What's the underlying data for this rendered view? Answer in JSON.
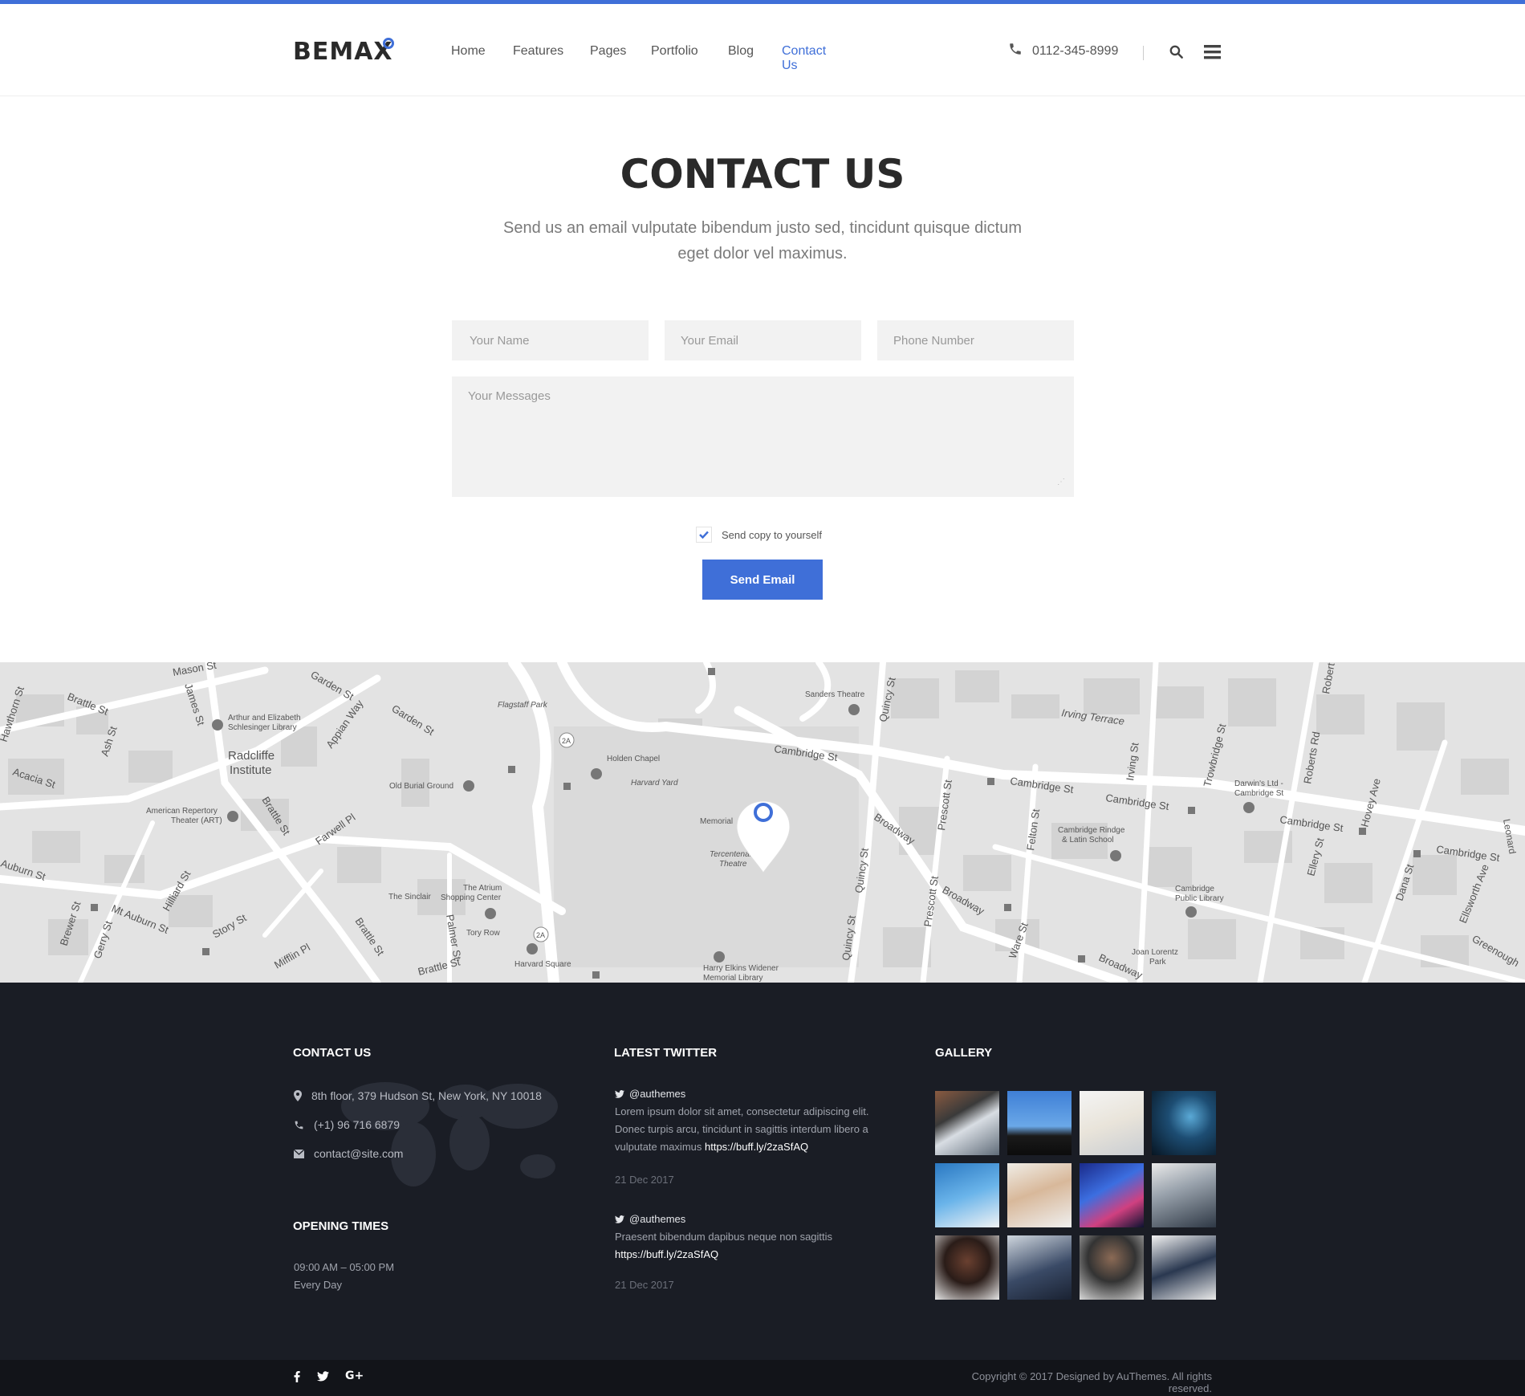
{
  "theme": {
    "accent": "#3f6fd8",
    "footer_bg": "#1a1d25",
    "bottom_bg": "#121419",
    "field_bg": "#f2f2f2"
  },
  "header": {
    "logo": "BEMAX",
    "nav": [
      {
        "label": "Home",
        "active": false
      },
      {
        "label": "Features",
        "active": false
      },
      {
        "label": "Pages",
        "active": false
      },
      {
        "label": "Portfolio",
        "active": false
      },
      {
        "label": "Blog",
        "active": false
      },
      {
        "label": "Contact Us",
        "active": true
      }
    ],
    "phone": "0112-345-8999",
    "icons": [
      "phone-icon",
      "search-icon",
      "menu-icon"
    ]
  },
  "contact": {
    "title": "CONTACT US",
    "subtitle": "Send us an email vulputate bibendum justo sed, tincidunt quisque dictum eget dolor vel maximus.",
    "form": {
      "name_placeholder": "Your Name",
      "email_placeholder": "Your Email",
      "phone_placeholder": "Phone Number",
      "message_placeholder": "Your Messages",
      "copy_label": "Send copy to yourself",
      "copy_checked": true,
      "submit_label": "Send Email"
    }
  },
  "map": {
    "labels": {
      "flagstaff": "Flagstaff Park",
      "sanders": "Sanders Theatre",
      "harvard_yard": "Harvard Yard",
      "holden": "Holden Chapel",
      "memorial": "Memorial",
      "tercentenary": "Tercentenary",
      "theatre": "Theatre",
      "radcliffe1": "Radcliffe",
      "radcliffe2": "Institute",
      "schlesinger1": "Arthur and Elizabeth",
      "schlesinger2": "Schlesinger Library",
      "burial": "Old Burial Ground",
      "art1": "American Repertory",
      "art2": "Theater (ART)",
      "sinclair": "The Sinclair",
      "atrium1": "The Atrium",
      "atrium2": "Shopping Center",
      "tory": "Tory Row",
      "harvard_sq": "Harvard Square",
      "widener1": "Harry Elkins Widener",
      "widener2": "Memorial Library",
      "crls1": "Cambridge Rindge",
      "crls2": "& Latin School",
      "cpl1": "Cambridge",
      "cpl2": "Public Library",
      "darwin1": "Darwin's Ltd -",
      "darwin2": "Cambridge St",
      "joan1": "Joan Lorentz",
      "joan2": "Park",
      "irving_terrace": "Irving Terrace",
      "cambridge_st": "Cambridge St",
      "broadway": "Broadway",
      "quincy": "Quincy St",
      "prescott": "Prescott St",
      "felton": "Felton St",
      "brattle": "Brattle St",
      "mason": "Mason St",
      "garden": "Garden St",
      "appian": "Appian Way",
      "farwell": "Farwell Pl",
      "mt_auburn": "Mt Auburn St",
      "story": "Story St",
      "hilliard": "Hilliard St",
      "mifflin": "Mifflin Pl",
      "palmer": "Palmer St",
      "acacia": "Acacia St",
      "auburn": "Auburn St",
      "hawthorn": "Hawthorn St",
      "ash": "Ash St",
      "james": "James St",
      "brewer": "Brewer St",
      "gerry": "Gerry St",
      "ellery": "Ellery St",
      "dana": "Dana St",
      "ellsworth": "Ellsworth Ave",
      "greenough": "Greenough",
      "irving": "Irving St",
      "trowbridge": "Trowbridge St",
      "roberts": "Roberts Rd",
      "hovey": "Hovey Ave",
      "robert": "Robert",
      "ware": "Ware St",
      "route_2a": "2A",
      "leonard": "Leonard"
    }
  },
  "footer": {
    "contact": {
      "heading": "CONTACT US",
      "address": "8th floor, 379 Hudson St, New York, NY 10018",
      "phone": "(+1) 96 716 6879",
      "email": "contact@site.com"
    },
    "opening": {
      "heading": "OPENING TIMES",
      "hours": "09:00 AM – 05:00 PM",
      "days": "Every Day"
    },
    "twitter": {
      "heading": "LATEST TWITTER",
      "tweets": [
        {
          "handle": "@authemes",
          "text": "Lorem ipsum dolor sit amet, consectetur adipiscing elit. Donec turpis arcu, tincidunt in sagittis interdum libero a vulputate maximus ",
          "link": "https://buff.ly/2zaSfAQ",
          "date": "21 Dec 2017"
        },
        {
          "handle": "@authemes",
          "text": "Praesent bibendum dapibus neque non sagittis ",
          "link": "https://buff.ly/2zaSfAQ",
          "date": "21 Dec 2017"
        }
      ]
    },
    "gallery": {
      "heading": "GALLERY"
    }
  },
  "bottom": {
    "social": [
      "facebook-icon",
      "twitter-icon",
      "google-plus-icon"
    ],
    "copyright": "Copyright © 2017 Designed by AuThemes. All rights reserved."
  }
}
